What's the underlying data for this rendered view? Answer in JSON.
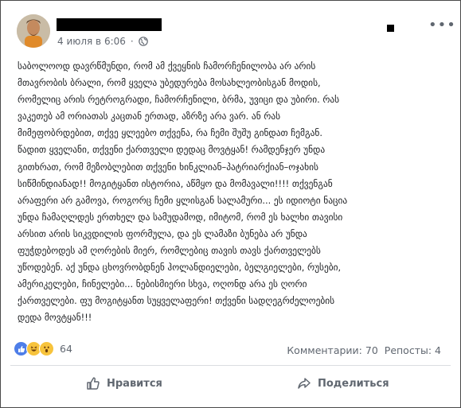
{
  "post": {
    "date_text": "4 июля в 6:06",
    "separator": "·",
    "body": "საბოლოოდ დავრწმუნდი, რომ ამ ქვეყნის ჩამორჩენილობა არ არის\nმთავრობის ბრალი, რომ ყველა უბედურება მოსახლეობისგან მოდის,\nრომელიც არის რეტროგრადი, ჩამორჩენილი, ბრმა, უვიცი და უბირი. რას\nვაკეთებ ამ ორიათას კაცთან ერთად, აზრზე არა ვარ. ან რას\nმიმეფობრდებით, თქვე ყლეებო თქვენა, რა ჩემი შუშუ გინდათ ჩემგან.\nწადით ყველანი, თქვენი ქართველი დედაც მოვტყან! რამდენჯერ უნდა\nგითხრათ, რომ მეზობლებით თქვენი ხინკლიან–პატრიარქიან–ოჯახის\nსიწმინდიანად!! მოგიტყანთ ისტორია, აწმყო და მომავალი!!!! თქვენგან\nარაფერი არ გამოვა, როგორც ჩემი ყლისგან სალამური... ეს იდიოტი ნაცია\nუნდა ჩამაღლდეს ერთხელ და სამუდამოდ, იმიტომ, რომ ეს ხალხი თავისი\nარსით არის სიკვდილის ფორმულა, და ეს ლამაზი ბუნება არ უნდა\nფუჭდებოდეს ამ ღორების მიერ, რომლებიც თავის თავს ქართველებს\nუწოდებენ. აქ უნდა ცხოვრობდნენ ჰოლანდიელები, ბელგიელები, რუსები,\nამერიკელები, ჩინელები... ნებისმიერი სხვა, ოღონდ არა ეს ღორი\nქართველები. ფუ მოგიტყანთ სუყველაფერი! თქვენი სადღეგრძელოების\nდედა მოვტყან!!!"
  },
  "reactions": {
    "count": "64",
    "types": [
      "like-icon",
      "haha-icon",
      "wow-icon"
    ],
    "colors": {
      "like": "#4e7ee8",
      "haha": "#f7c33c",
      "wow": "#f7c33c"
    }
  },
  "stats": {
    "comments": "Комментарии: 70",
    "shares": "Репосты: 4"
  },
  "actions": {
    "like_label": "Нравится",
    "share_label": "Поделиться"
  },
  "icons": {
    "more": "•••",
    "globe": "globe-icon"
  }
}
